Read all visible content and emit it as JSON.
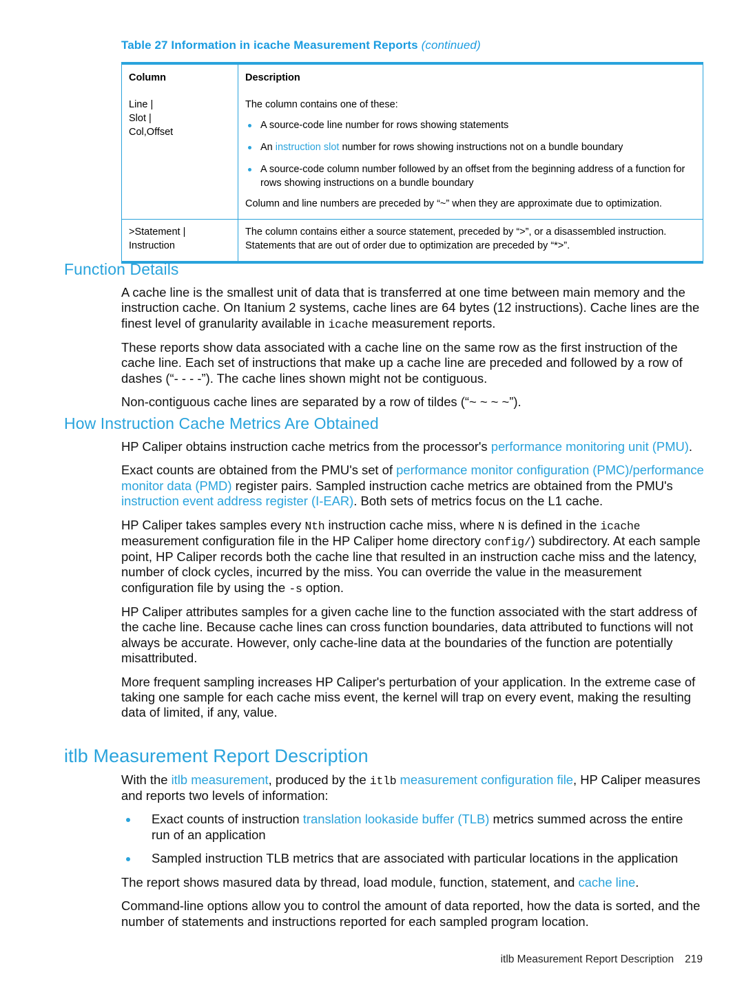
{
  "table": {
    "caption_main": "Table 27 Information in icache Measurement Reports",
    "caption_continued": "(continued)",
    "headers": [
      "Column",
      "Description"
    ],
    "rows": [
      {
        "column": "Line |\nSlot |\nCol,Offset",
        "lead": "The column contains one of these:",
        "bullets": [
          "A source-code line number for rows showing statements",
          "An instruction slot number for rows showing instructions not on a bundle boundary",
          "A source-code column number followed by an offset from the beginning address of a function for rows showing instructions on a bundle boundary"
        ],
        "tail": "Column and line numbers are preceded by “~” when they are approximate due to optimization."
      },
      {
        "column": ">Statement |\nInstruction",
        "lines": [
          "The column contains either a source statement, preceded by “>”, or a disassembled instruction.",
          "Statements that are out of order due to optimization are preceded by “*>”."
        ]
      }
    ]
  },
  "sections": {
    "function_details": {
      "heading": "Function Details",
      "p1_a": "A cache line is the smallest unit of data that is transferred at one time between main memory and the instruction cache. On Itanium 2 systems, cache lines are 64 bytes (12 instructions). Cache lines are the finest level of granularity available in ",
      "p1_code": "icache",
      "p1_b": " measurement reports.",
      "p2": "These reports show data associated with a cache line on the same row as the first instruction of the cache line. Each set of instructions that make up a cache line are preceded and followed by a row of dashes (“- - - -”). The cache lines shown might not be contiguous.",
      "p3": "Non-contiguous cache lines are separated by a row of tildes (“~ ~ ~ ~”)."
    },
    "how_metrics": {
      "heading": "How Instruction Cache Metrics Are Obtained",
      "p1_a": "HP Caliper obtains instruction cache metrics from the processor's ",
      "p1_link": "performance monitoring unit (PMU)",
      "p1_b": ".",
      "p2_a": "Exact counts are obtained from the PMU's set of ",
      "p2_link1": "performance monitor configuration (PMC)/performance monitor data (PMD)",
      "p2_b": " register pairs. Sampled instruction cache metrics are obtained from the PMU's ",
      "p2_link2": "instruction event address register (I-EAR)",
      "p2_c": ". Both sets of metrics focus on the L1 cache.",
      "p3_a": "HP Caliper takes samples every ",
      "p3_code1": "Nth",
      "p3_b": " instruction cache miss, where ",
      "p3_code2": "N",
      "p3_c": " is defined in the ",
      "p3_code3": "icache",
      "p3_d": " measurement configuration file in the HP Caliper home directory ",
      "p3_code4": "config/",
      "p3_e": ") subdirectory. At each sample point, HP Caliper records both the cache line that resulted in an instruction cache miss and the latency, number of clock cycles, incurred by the miss. You can override the value in the measurement configuration file by using the ",
      "p3_code5": "-s",
      "p3_f": " option.",
      "p4": "HP Caliper attributes samples for a given cache line to the function associated with the start address of the cache line. Because cache lines can cross function boundaries, data attributed to functions will not always be accurate. However, only cache-line data at the boundaries of the function are potentially misattributed.",
      "p5": "More frequent sampling increases HP Caliper's perturbation of your application. In the extreme case of taking one sample for each cache miss event, the kernel will trap on every event, making the resulting data of limited, if any, value."
    },
    "itlb": {
      "heading": "itlb Measurement Report Description",
      "p1_a": "With the ",
      "p1_link1": "itlb measurement",
      "p1_b": ", produced by the ",
      "p1_code": "itlb",
      "p1_link2": " measurement configuration file",
      "p1_c": ", HP Caliper measures and reports two levels of information:",
      "bullet1_a": "Exact counts of instruction ",
      "bullet1_link": "translation lookaside buffer (TLB)",
      "bullet1_b": " metrics summed across the entire run of an application",
      "bullet2": "Sampled instruction TLB metrics that are associated with particular locations in the application",
      "p2_a": "The report shows masured data by thread, load module, function, statement, and ",
      "p2_link": "cache line",
      "p2_b": ".",
      "p3": "Command-line options allow you to control the amount of data reported, how the data is sorted, and the number of statements and instructions reported for each sampled program location."
    }
  },
  "footer": {
    "title": "itlb Measurement Report Description",
    "page_number": "219"
  },
  "colors": {
    "accent_blue": "#29a3dc",
    "body_text": "#111111"
  }
}
